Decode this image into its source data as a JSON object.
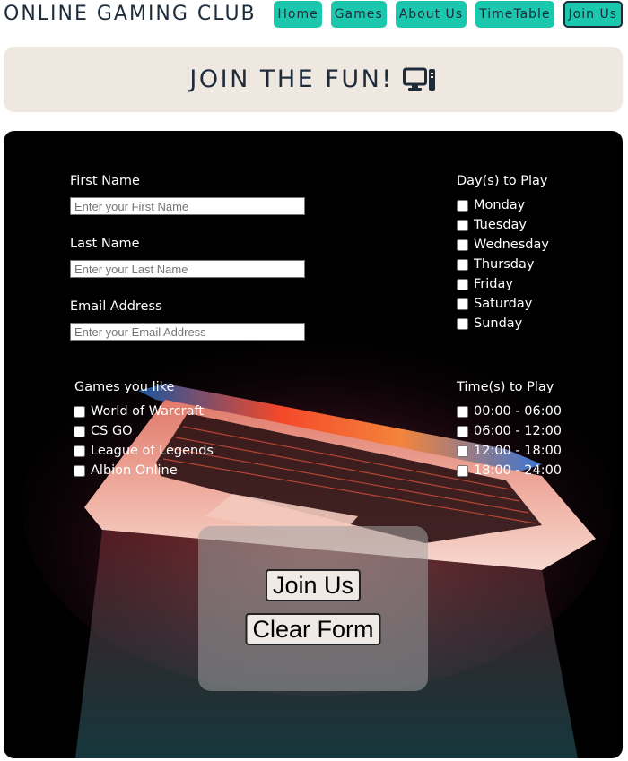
{
  "header": {
    "brand": "ONLINE GAMING CLUB",
    "nav": [
      {
        "label": "Home",
        "active": false
      },
      {
        "label": "Games",
        "active": false
      },
      {
        "label": "About Us",
        "active": false
      },
      {
        "label": "TimeTable",
        "active": false
      },
      {
        "label": "Join Us",
        "active": true
      }
    ]
  },
  "banner": {
    "title": "JOIN THE FUN!",
    "icon": "desktop-computer-icon"
  },
  "form": {
    "first_name": {
      "label": "First Name",
      "placeholder": "Enter your First Name",
      "value": ""
    },
    "last_name": {
      "label": "Last Name",
      "placeholder": "Enter your Last Name",
      "value": ""
    },
    "email": {
      "label": "Email Address",
      "placeholder": "Enter your Email Address",
      "value": ""
    },
    "days": {
      "label": "Day(s) to Play",
      "options": [
        "Monday",
        "Tuesday",
        "Wednesday",
        "Thursday",
        "Friday",
        "Saturday",
        "Sunday"
      ]
    },
    "games": {
      "label": "Games you like",
      "options": [
        "World of Warcraft",
        "CS GO",
        "League of Legends",
        "Albion Online"
      ]
    },
    "times": {
      "label": "Time(s) to Play",
      "options": [
        "00:00 - 06:00",
        "06:00 - 12:00",
        "12:00 - 18:00",
        "18:00 - 24:00"
      ]
    },
    "submit_label": "Join Us",
    "clear_label": "Clear Form"
  },
  "colors": {
    "accent": "#1bc8ae",
    "text_dark": "#1d2b3a",
    "banner_bg": "#efe8e1",
    "panel_bg": "#000000"
  }
}
